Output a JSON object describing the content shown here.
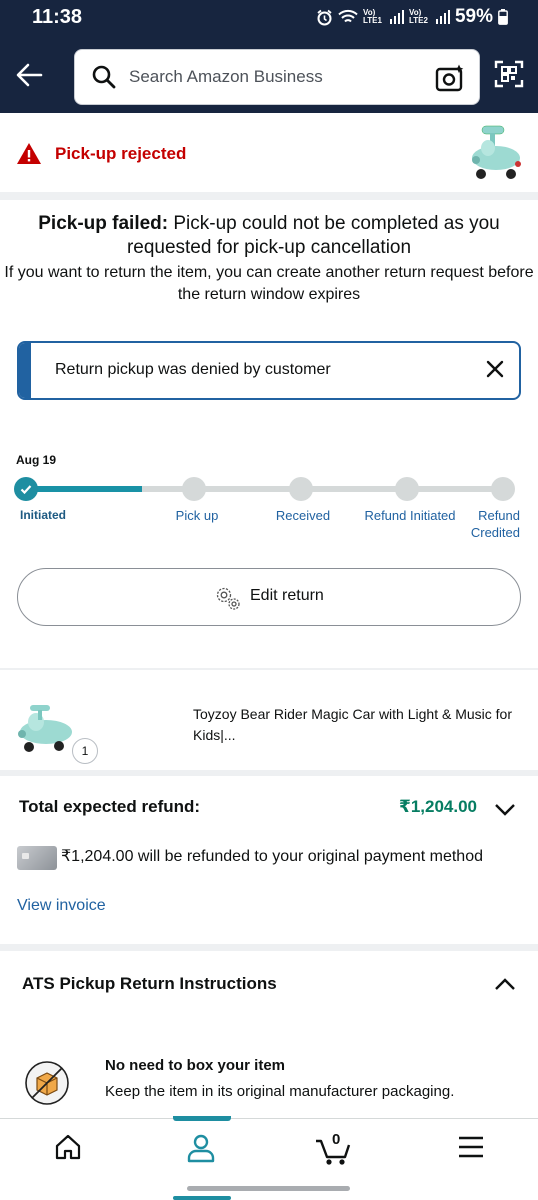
{
  "status_bar": {
    "time": "11:38",
    "net1": "Vo) LTE1",
    "net2": "Vo) LTE2",
    "battery": "59%"
  },
  "search": {
    "placeholder": "Search Amazon Business"
  },
  "status": {
    "title": "Pick-up rejected"
  },
  "failure": {
    "bold": "Pick-up failed:",
    "rest": " Pick-up could not be completed as you requested for pick-up cancellation",
    "detail": "If you want to return the item, you can create another return request before the return window expires"
  },
  "alert": {
    "message": "Return pickup was denied by customer"
  },
  "timeline": {
    "date": "Aug 19",
    "steps": [
      "Initiated",
      "Pick up",
      "Received",
      "Refund Initiated",
      "Refund Credited"
    ],
    "completed_steps": 1
  },
  "edit_return": {
    "label": "Edit return"
  },
  "item": {
    "title": "Toyzoy Bear Rider Magic Car with Light & Music for Kids|...",
    "quantity": "1"
  },
  "refund": {
    "label": "Total expected refund:",
    "amount": "₹1,204.00",
    "note": "₹1,204.00 will be refunded to your original payment method",
    "invoice_link": "View invoice"
  },
  "instructions": {
    "title": "ATS Pickup Return Instructions",
    "heading": "No need to box your item",
    "text": "Keep the item in its original manufacturer packaging."
  },
  "bottom_nav": {
    "cart_count": "0"
  },
  "colors": {
    "header": "#17253f",
    "accent": "#1e8ea1",
    "link": "#2162a1",
    "error": "#c40000",
    "success": "#067d62"
  }
}
